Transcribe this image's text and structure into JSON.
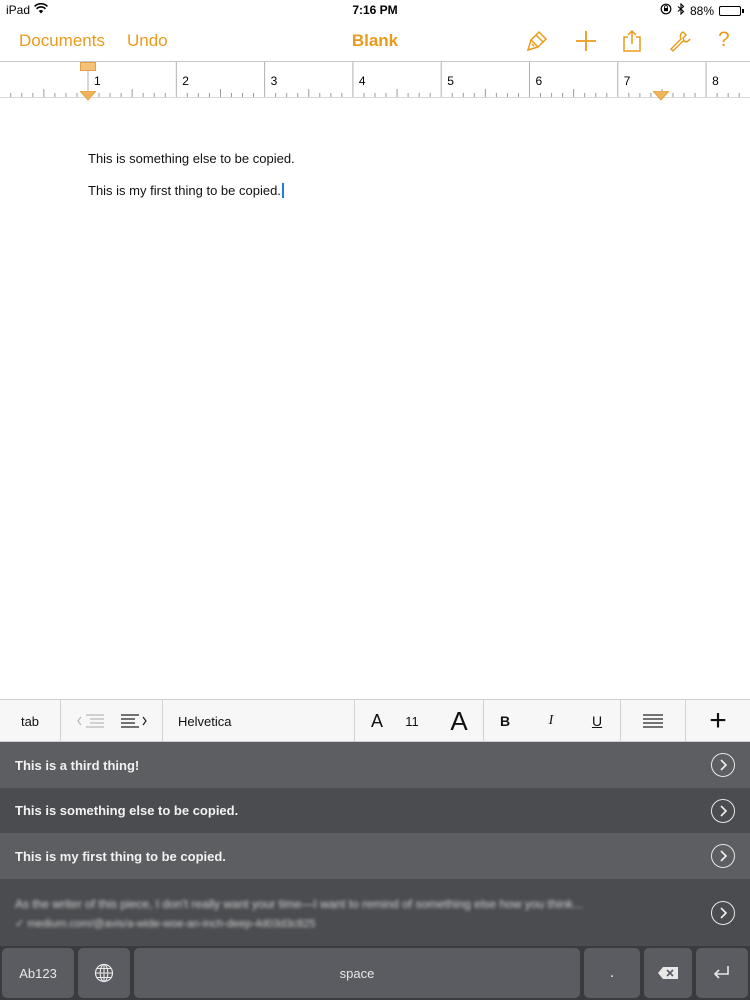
{
  "status_bar": {
    "device": "iPad",
    "time": "7:16 PM",
    "battery": "88%",
    "battery_level": 0.88
  },
  "toolbar": {
    "documents_label": "Documents",
    "undo_label": "Undo",
    "title": "Blank",
    "icons": [
      "paintbrush-icon",
      "plus-icon",
      "share-icon",
      "wrench-icon",
      "help-icon"
    ],
    "help_label": "?",
    "accent_color": "#eb9b1b"
  },
  "ruler": {
    "numbers": [
      "1",
      "2",
      "3",
      "4",
      "5",
      "6",
      "7",
      "8"
    ]
  },
  "document": {
    "lines": [
      "This is something else to be copied.",
      "This is my first thing to be copied."
    ]
  },
  "shortcut_bar": {
    "tab_label": "tab",
    "font_name": "Helvetica",
    "font_size_down": "A",
    "font_size": "11",
    "font_size_up": "A",
    "bold_label": "B",
    "italic_label": "I",
    "underline_label": "U",
    "add_label": "+"
  },
  "suggestions": {
    "items": [
      "This is a third thing!",
      "This is something else to be copied.",
      "This is my first thing to be copied."
    ],
    "blurred_line_1": "As the writer of this piece, I don't really want your time—I want to remind of something else how you think...",
    "blurred_line_2": "✓ medium.com/@avis/a-wide-woe-an-inch-deep-4d03d3c825"
  },
  "keyboard": {
    "mode_label": "Ab123",
    "space_label": "space",
    "period_label": "."
  }
}
